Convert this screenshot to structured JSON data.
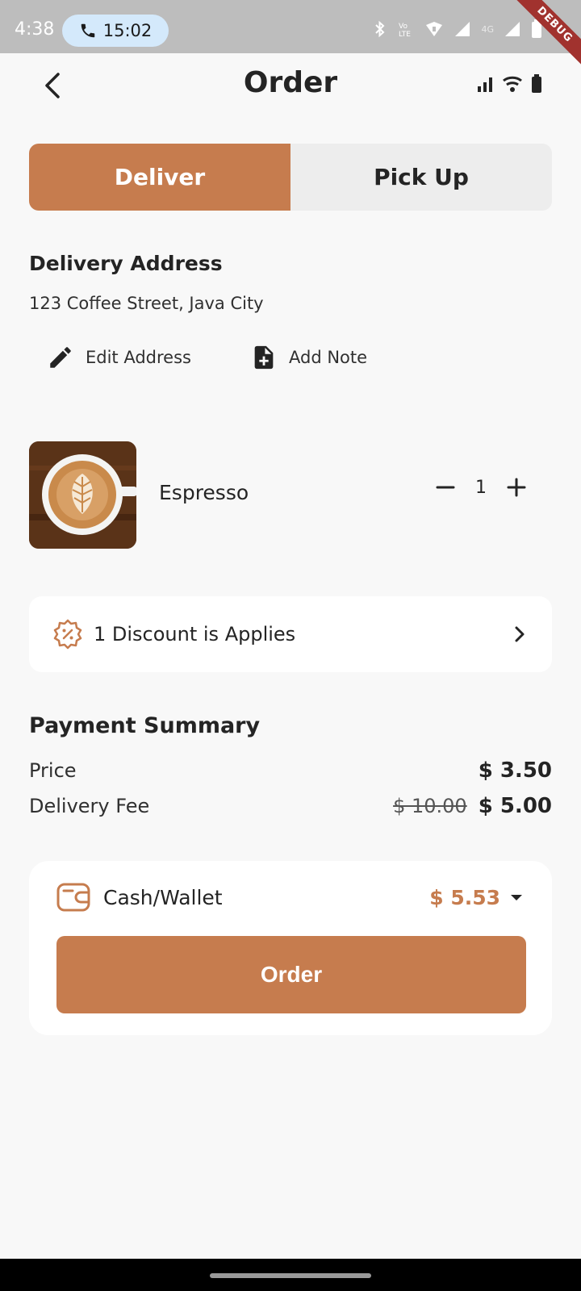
{
  "status_bar": {
    "time": "4:38",
    "call_time": "15:02",
    "network_label": "4G",
    "ribbon": "DEBUG"
  },
  "app_bar": {
    "title": "Order"
  },
  "tabs": {
    "deliver": "Deliver",
    "pickup": "Pick Up",
    "active": "deliver"
  },
  "delivery": {
    "title": "Delivery Address",
    "address": "123 Coffee Street, Java City",
    "edit_label": "Edit Address",
    "note_label": "Add Note"
  },
  "item": {
    "name": "Espresso",
    "quantity": "1"
  },
  "discount": {
    "text": "1 Discount is Applies"
  },
  "summary": {
    "title": "Payment Summary",
    "price_label": "Price",
    "price_value": "$ 3.50",
    "fee_label": "Delivery Fee",
    "fee_original": "$ 10.00",
    "fee_value": "$ 5.00"
  },
  "payment": {
    "method": "Cash/Wallet",
    "amount": "$ 5.53",
    "order_label": "Order"
  },
  "colors": {
    "accent": "#c67c4e",
    "background": "#f8f8f8",
    "card": "#ffffff"
  }
}
